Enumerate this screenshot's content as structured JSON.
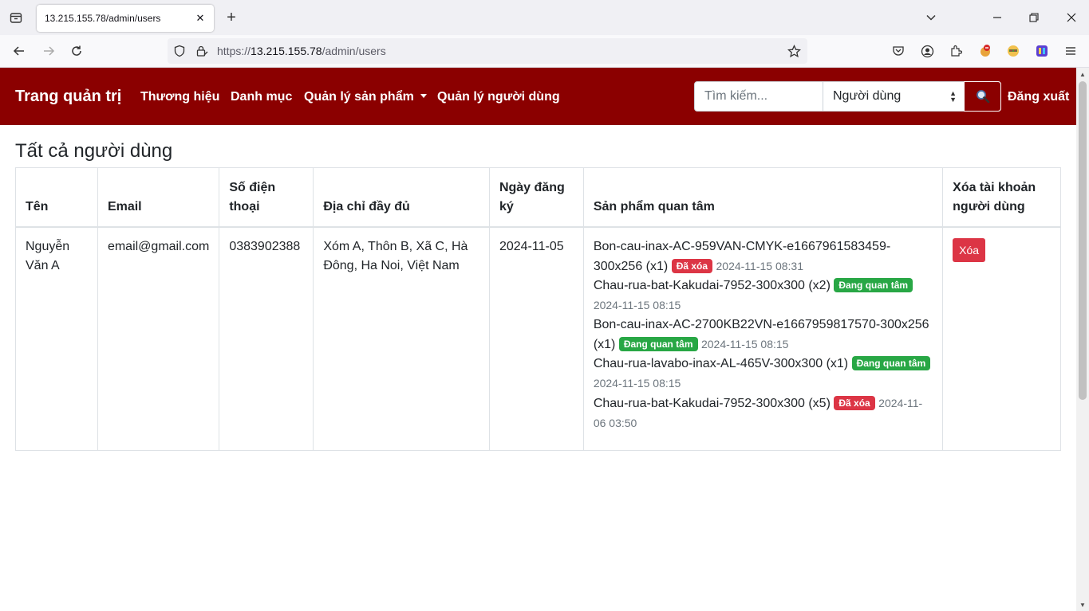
{
  "browser": {
    "tab_title": "13.215.155.78/admin/users",
    "url_scheme": "https://",
    "url_host": "13.215.155.78",
    "url_path": "/admin/users"
  },
  "nav": {
    "brand": "Trang quản trị",
    "links": [
      "Thương hiệu",
      "Danh mục",
      "Quản lý sản phẩm",
      "Quản lý người dùng"
    ],
    "search_placeholder": "Tìm kiếm...",
    "search_type": "Người dùng",
    "logout": "Đăng xuất"
  },
  "page": {
    "title": "Tất cả người dùng"
  },
  "table": {
    "headers": [
      "Tên",
      "Email",
      "Số điện thoại",
      "Địa chỉ đầy đủ",
      "Ngày đăng ký",
      "Sản phẩm quan tâm",
      "Xóa tài khoản người dùng"
    ],
    "rows": [
      {
        "name": "Nguyễn Văn A",
        "email": "email@gmail.com",
        "phone": "0383902388",
        "address": "Xóm A, Thôn B, Xã C, Hà Đông, Ha Noi, Việt Nam",
        "registered": "2024-11-05",
        "products": [
          {
            "name": "Bon-cau-inax-AC-959VAN-CMYK-e1667961583459-300x256",
            "qty": "(x1)",
            "status": "Đã xóa",
            "status_color": "#dc3545",
            "time": "2024-11-15 08:31"
          },
          {
            "name": "Chau-rua-bat-Kakudai-7952-300x300",
            "qty": "(x2)",
            "status": "Đang quan tâm",
            "status_color": "#28a745",
            "time": "2024-11-15 08:15"
          },
          {
            "name": "Bon-cau-inax-AC-2700KB22VN-e1667959817570-300x256",
            "qty": "(x1)",
            "status": "Đang quan tâm",
            "status_color": "#28a745",
            "time": "2024-11-15 08:15"
          },
          {
            "name": "Chau-rua-lavabo-inax-AL-465V-300x300",
            "qty": "(x1)",
            "status": "Đang quan tâm",
            "status_color": "#28a745",
            "time": "2024-11-15 08:15"
          },
          {
            "name": "Chau-rua-bat-Kakudai-7952-300x300",
            "qty": "(x5)",
            "status": "Đã xóa",
            "status_color": "#dc3545",
            "time": "2024-11-06 03:50"
          }
        ],
        "delete_label": "Xóa"
      }
    ]
  },
  "colors": {
    "navbar_bg": "#8b0000",
    "danger": "#dc3545",
    "success": "#28a745"
  }
}
